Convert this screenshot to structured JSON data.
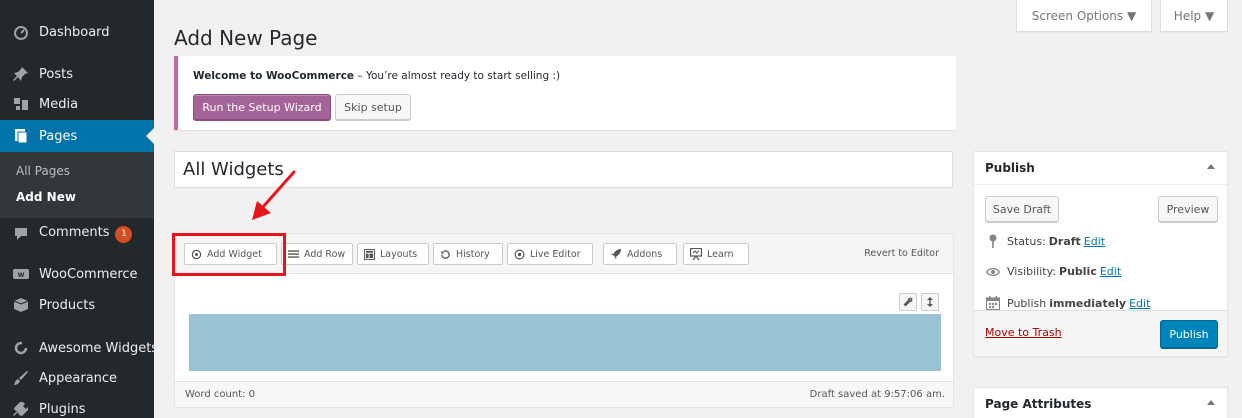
{
  "sidebar": {
    "items": [
      {
        "label": "Dashboard",
        "icon": "dashboard-icon"
      },
      {
        "label": "Posts",
        "icon": "pin-icon"
      },
      {
        "label": "Media",
        "icon": "media-icon"
      },
      {
        "label": "Pages",
        "icon": "pages-icon",
        "current": true
      },
      {
        "label": "Comments",
        "icon": "comments-icon",
        "badge": "1"
      },
      {
        "label": "WooCommerce",
        "icon": "woocommerce-icon"
      },
      {
        "label": "Products",
        "icon": "products-icon"
      },
      {
        "label": "Awesome Widgets",
        "icon": "awesome-widgets-icon"
      },
      {
        "label": "Appearance",
        "icon": "appearance-icon"
      },
      {
        "label": "Plugins",
        "icon": "plugins-icon"
      }
    ],
    "submenu": [
      {
        "label": "All Pages"
      },
      {
        "label": "Add New",
        "active": true
      }
    ]
  },
  "top_tabs": {
    "screen_options": "Screen Options ▼",
    "help": "Help ▼"
  },
  "page_title": "Add New Page",
  "woo_notice": {
    "bold": "Welcome to WooCommerce",
    "text": " – You’re almost ready to start selling :)",
    "setup_wizard": "Run the Setup Wizard",
    "skip_setup": "Skip setup"
  },
  "title_field": {
    "value": "All Widgets"
  },
  "builder": {
    "toolbar": [
      {
        "label": "Add Widget",
        "icon": "gear-icon"
      },
      {
        "label": "Add Row",
        "icon": "rows-icon"
      },
      {
        "label": "Layouts",
        "icon": "layouts-icon"
      },
      {
        "label": "History",
        "icon": "history-icon"
      },
      {
        "label": "Live Editor",
        "icon": "eye-icon"
      },
      {
        "label": "Addons",
        "icon": "rocket-icon"
      },
      {
        "label": "Learn",
        "icon": "presentation-icon"
      }
    ],
    "revert": "Revert to Editor",
    "word_count": "Word count: 0",
    "draft_saved": "Draft saved at 9:57:06 am."
  },
  "publish_box": {
    "title": "Publish",
    "save_draft": "Save Draft",
    "preview": "Preview",
    "status_label": "Status:",
    "status_value": "Draft",
    "visibility_label": "Visibility:",
    "visibility_value": "Public",
    "publish_label": "Publish",
    "publish_value": "immediately",
    "edit": "Edit",
    "move_to_trash": "Move to Trash",
    "publish_button": "Publish"
  },
  "page_attributes": {
    "title": "Page Attributes"
  },
  "colors": {
    "sidebar": "#23282d",
    "accent": "#0073aa",
    "woo": "#a46497",
    "highlight": "#e8141c",
    "row": "#9bc3d6"
  }
}
